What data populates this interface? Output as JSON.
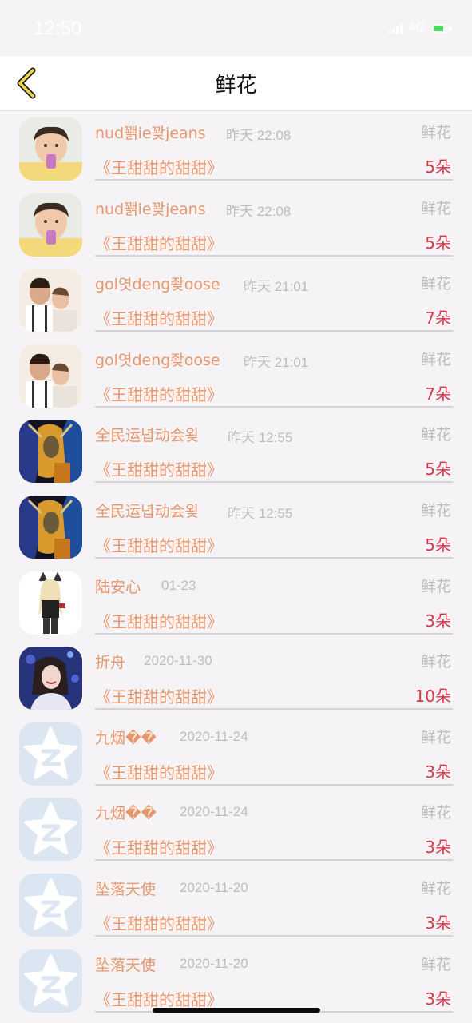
{
  "status": {
    "time": "12:50",
    "network": "4G"
  },
  "nav": {
    "title": "鲜花"
  },
  "rows": [
    {
      "name": "nud꽭ie꽞jeans",
      "time": "昨天 22:08",
      "type": "鲜花",
      "book": "《王甜甜的甜甜》",
      "count": "5朵",
      "avatar": "boy-avatar"
    },
    {
      "name": "nud꽭ie꽞jeans",
      "time": "昨天 22:08",
      "type": "鲜花",
      "book": "《王甜甜的甜甜》",
      "count": "5朵",
      "avatar": "boy-avatar"
    },
    {
      "name": "gol엿deng좢oose",
      "time": "昨天 21:01",
      "type": "鲜花",
      "book": "《王甜甜的甜甜》",
      "count": "7朵",
      "avatar": "family-avatar"
    },
    {
      "name": "gol엿deng좢oose",
      "time": "昨天 21:01",
      "type": "鲜花",
      "book": "《王甜甜的甜甜》",
      "count": "7朵",
      "avatar": "family-avatar"
    },
    {
      "name": "全民运녑动会욎",
      "time": "昨天 12:55",
      "type": "鲜花",
      "book": "《王甜甜的甜甜》",
      "count": "5朵",
      "avatar": "game-character-avatar"
    },
    {
      "name": "全民运녑动会욎",
      "time": "昨天 12:55",
      "type": "鲜花",
      "book": "《王甜甜的甜甜》",
      "count": "5朵",
      "avatar": "game-character-avatar"
    },
    {
      "name": "陆安心",
      "time": "01-23",
      "type": "鲜花",
      "book": "《王甜甜的甜甜》",
      "count": "3朵",
      "avatar": "anime-girl-avatar"
    },
    {
      "name": "折舟",
      "time": "2020-11-30",
      "type": "鲜花",
      "book": "《王甜甜的甜甜》",
      "count": "10朵",
      "avatar": "singer-avatar"
    },
    {
      "name": "九烟��",
      "time": "2020-11-24",
      "type": "鲜花",
      "book": "《王甜甜的甜甜》",
      "count": "3朵",
      "avatar": "default-star-avatar"
    },
    {
      "name": "九烟��",
      "time": "2020-11-24",
      "type": "鲜花",
      "book": "《王甜甜的甜甜》",
      "count": "3朵",
      "avatar": "default-star-avatar"
    },
    {
      "name": "坠落天使",
      "time": "2020-11-20",
      "type": "鲜花",
      "book": "《王甜甜的甜甜》",
      "count": "3朵",
      "avatar": "default-star-avatar"
    },
    {
      "name": "坠落天使",
      "time": "2020-11-20",
      "type": "鲜花",
      "book": "《王甜甜的甜甜》",
      "count": "3朵",
      "avatar": "default-star-avatar"
    }
  ],
  "colors": {
    "name": "#e8976b",
    "count": "#d8374a",
    "meta": "#bdbdbd",
    "back_arrow": "#f2d64a"
  }
}
